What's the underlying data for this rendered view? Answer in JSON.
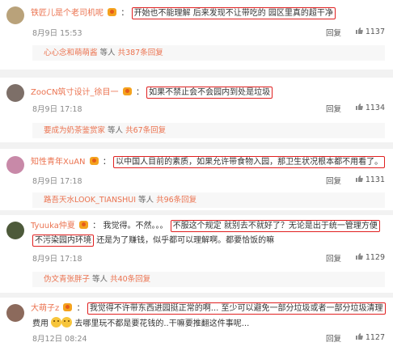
{
  "comments": [
    {
      "username": "铁匠儿是个老司机呢",
      "text": "开始也不能理解 后来发现不让带吃的 园区里真的超干净",
      "date": "8月9日 15:53",
      "reply_label": "回复",
      "likes": "1137",
      "sub": {
        "who": "心心念和萌萌酱",
        "rest": " 等人 ",
        "count": "共387条回复"
      },
      "avatar_color": "#b9a27a"
    },
    {
      "username": "ZooCN筑寸设计_徐目一",
      "text": "如果不禁止会不会园内到处是垃圾",
      "date": "8月9日 17:18",
      "reply_label": "回复",
      "likes": "1134",
      "sub": {
        "who": "要成为奶茶鉴赏家",
        "rest": " 等人 ",
        "count": "共67条回复"
      },
      "avatar_color": "#7d6f68"
    },
    {
      "username": "知性青年XuAN",
      "text": "以中国人目前的素质，如果允许带食物入园，那卫生状况根本都不用看了。",
      "date": "8月9日 17:18",
      "reply_label": "回复",
      "likes": "1131",
      "sub": {
        "who": "路吾天水LOOK_TIANSHUI",
        "rest": " 等人 ",
        "count": "共96条回复"
      },
      "avatar_color": "#c889a8"
    },
    {
      "username": "Tyuuka仲夏",
      "prefix": "我觉得。不然。。。",
      "text_line1": "不服这个规定 就别去不就好了？无论是出于统一管理方便",
      "text_line2": "不污染园内环境",
      "suffix": "还是为了赚钱，似乎都可以理解啊。都要恰饭的嘛",
      "date": "8月9日 17:18",
      "reply_label": "回复",
      "likes": "1129",
      "sub": {
        "who": "伪文青张胖子",
        "rest": " 等人 ",
        "count": "共40条回复"
      },
      "avatar_color": "#4d5a3a"
    },
    {
      "username": "大萌子z",
      "text": "我觉得不许带东西进园挺正常的啊... 至少可以避免一部分垃圾或者一部分垃圾清理",
      "line2a": "费用",
      "line2b": "去哪里玩不都是要花钱的..干嘛要推翻这件事呢...",
      "date": "8月12日 08:24",
      "reply_label": "回复",
      "likes": "1127",
      "avatar_color": "#8c6a5c"
    }
  ],
  "colors": {
    "username": "#eb7350",
    "highlight_border": "#e02020",
    "date": "#8a8a8a"
  },
  "icons": [
    "vip-badge-icon",
    "like-icon",
    "emoji-icon"
  ]
}
